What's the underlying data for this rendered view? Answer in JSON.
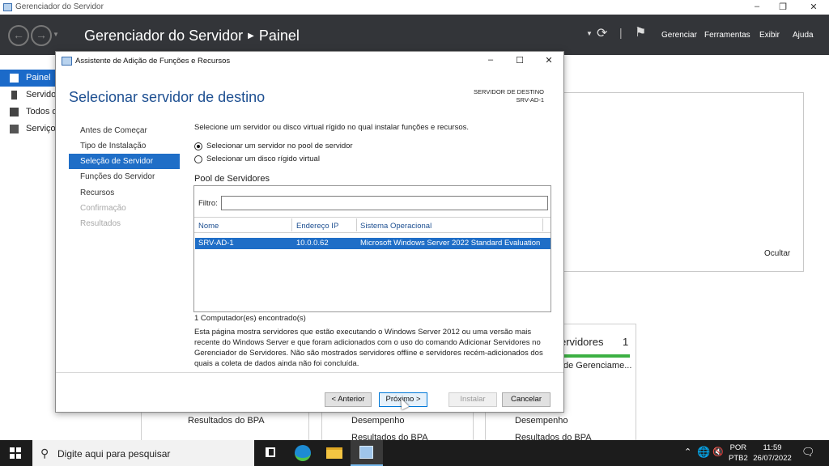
{
  "window": {
    "title": "Gerenciador do Servidor"
  },
  "header": {
    "app_name": "Gerenciador do Servidor",
    "section": "Painel",
    "menu": [
      "Gerenciar",
      "Ferramentas",
      "Exibir",
      "Ajuda"
    ]
  },
  "sidebar": {
    "items": [
      {
        "label": "Painel",
        "icon": "dashboard-icon",
        "active": true
      },
      {
        "label": "Servidor Local",
        "icon": "server-icon"
      },
      {
        "label": "Todos os Servidores",
        "icon": "servers-icon"
      },
      {
        "label": "Serviços de Arquivo e Armazenamento",
        "icon": "storage-icon"
      }
    ]
  },
  "background": {
    "hide_label": "Ocultar",
    "tile_title": "ervidores",
    "tile_count": "1",
    "tile_sub": "de Gerenciame...",
    "bpa_labels": [
      "Resultados do BPA",
      "Desempenho",
      "Resultados do BPA",
      "Desempenho",
      "Resultados do BPA"
    ]
  },
  "dialog": {
    "title": "Assistente de Adição de Funções e Recursos",
    "heading": "Selecionar servidor de destino",
    "dest_label": "SERVIDOR DE DESTINO",
    "dest_server": "SRV-AD-1",
    "steps": [
      {
        "label": "Antes de Começar",
        "state": "normal"
      },
      {
        "label": "Tipo de Instalação",
        "state": "normal"
      },
      {
        "label": "Seleção de Servidor",
        "state": "active"
      },
      {
        "label": "Funções do Servidor",
        "state": "normal"
      },
      {
        "label": "Recursos",
        "state": "normal"
      },
      {
        "label": "Confirmação",
        "state": "disabled"
      },
      {
        "label": "Resultados",
        "state": "disabled"
      }
    ],
    "instruction": "Selecione um servidor ou disco virtual rígido no qual instalar funções e recursos.",
    "options": [
      {
        "label": "Selecionar um servidor no pool de servidor",
        "checked": true
      },
      {
        "label": "Selecionar um disco rígido virtual",
        "checked": false
      }
    ],
    "pool": {
      "title": "Pool de Servidores",
      "filter_label": "Filtro:",
      "filter_value": "",
      "columns": [
        "Nome",
        "Endereço IP",
        "Sistema Operacional"
      ],
      "rows": [
        {
          "name": "SRV-AD-1",
          "ip": "10.0.0.62",
          "os": "Microsoft Windows Server 2022 Standard Evaluation",
          "selected": true
        }
      ]
    },
    "found": "1 Computador(es) encontrado(s)",
    "description": "Esta página mostra servidores que estão executando o Windows Server 2012 ou uma versão mais recente do Windows Server e que foram adicionados com o uso do comando Adicionar Servidores no Gerenciador de Servidores. Não são mostrados servidores offline e servidores recém-adicionados dos quais a coleta de dados ainda não foi concluída.",
    "buttons": {
      "previous": "< Anterior",
      "next": "Próximo >",
      "install": "Instalar",
      "cancel": "Cancelar"
    }
  },
  "taskbar": {
    "search_placeholder": "Digite aqui para pesquisar",
    "lang_top": "POR",
    "lang_bottom": "PTB2",
    "time": "11:59",
    "date": "26/07/2022"
  }
}
